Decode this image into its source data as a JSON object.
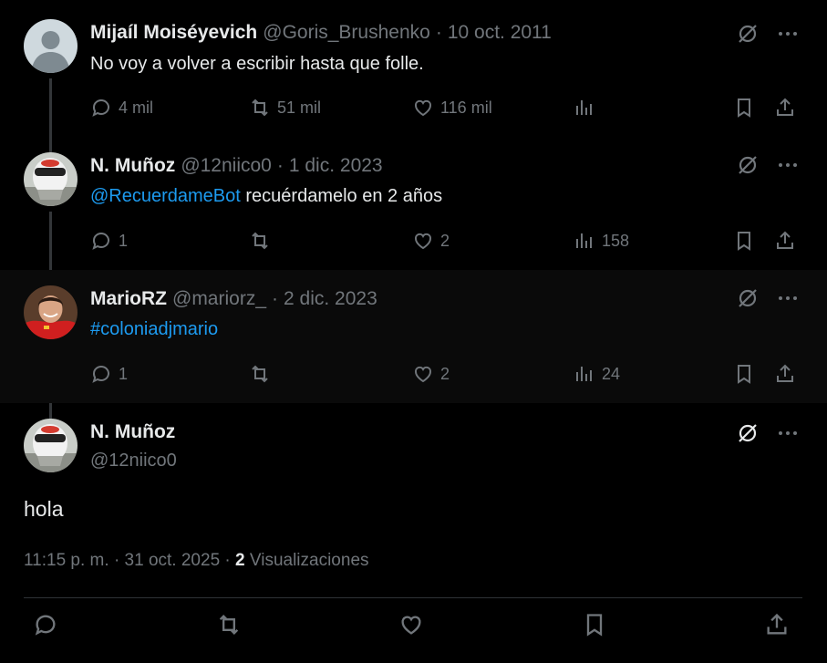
{
  "tweets": [
    {
      "name": "Mijaíl Moiséyevich",
      "handle": "@Goris_Brushenko",
      "sep": "·",
      "date": "10 oct. 2011",
      "text": "No voy a volver a escribir hasta que folle.",
      "replies": "4 mil",
      "retweets": "51 mil",
      "likes": "116 mil",
      "views": ""
    },
    {
      "name": "N. Muñoz",
      "handle": "@12niico0",
      "sep": "·",
      "date": "1 dic. 2023",
      "mention": "@RecuerdameBot",
      "text": " recuérdamelo en 2 años",
      "replies": "1",
      "retweets": "",
      "likes": "2",
      "views": "158"
    },
    {
      "name": "MarioRZ",
      "handle": "@mariorz_",
      "sep": "·",
      "date": "2 dic. 2023",
      "hashtag": "#coloniadjmario",
      "replies": "1",
      "retweets": "",
      "likes": "2",
      "views": "24"
    }
  ],
  "focus": {
    "name": "N. Muñoz",
    "handle": "@12niico0",
    "text": "hola",
    "time": "11:15 p. m.",
    "dot": "·",
    "date": "31 oct. 2025",
    "dot2": "·",
    "views_count": "2",
    "views_label": "Visualizaciones"
  },
  "icons": [
    "reply-icon",
    "retweet-icon",
    "like-icon",
    "views-icon",
    "bookmark-icon",
    "share-icon",
    "grok-icon",
    "more-icon",
    "avatar"
  ],
  "colors": {
    "background": "#000000",
    "text": "#e7e9ea",
    "muted": "#71767b",
    "link": "#1d9bf0",
    "line": "#333639"
  }
}
